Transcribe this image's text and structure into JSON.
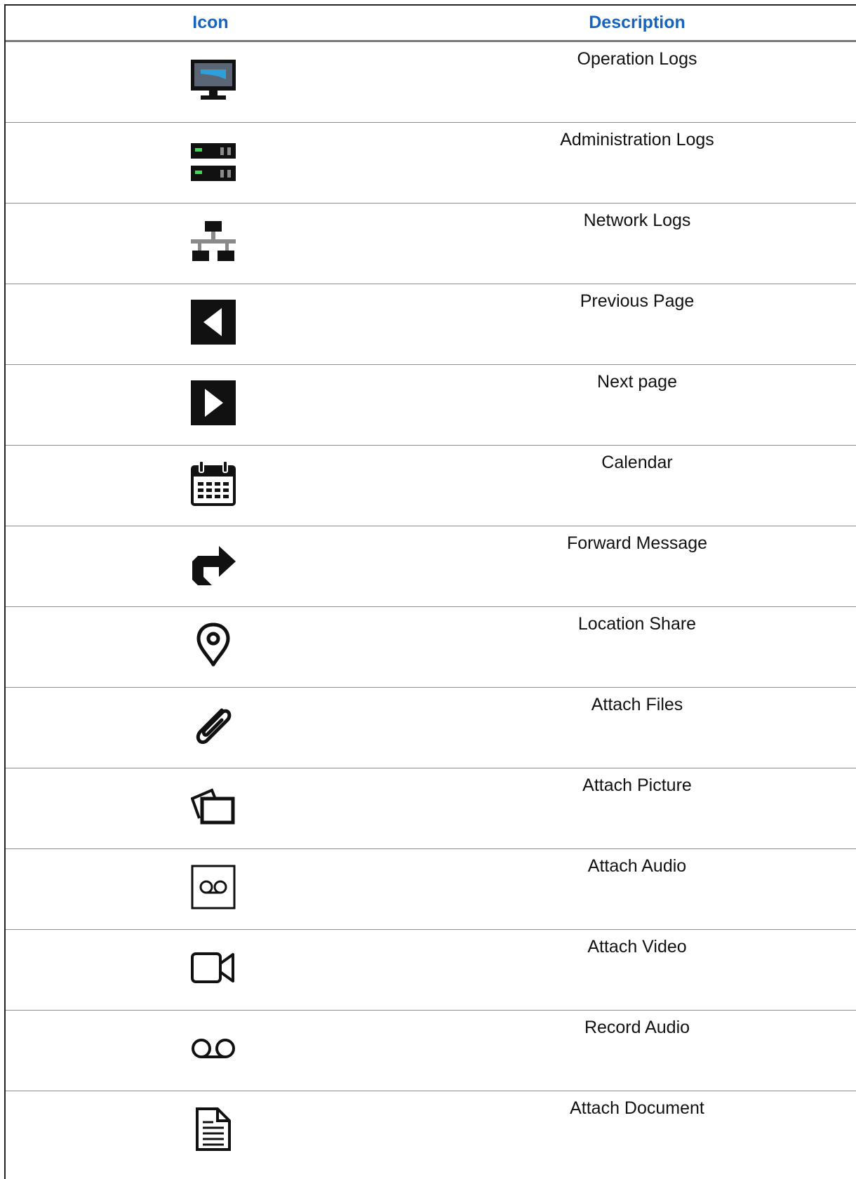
{
  "table": {
    "headers": {
      "icon": "Icon",
      "description": "Description"
    },
    "rows": [
      {
        "icon": "monitor-icon",
        "description": "Operation Logs"
      },
      {
        "icon": "server-icon",
        "description": "Administration Logs"
      },
      {
        "icon": "network-icon",
        "description": "Network Logs"
      },
      {
        "icon": "previous-page-icon",
        "description": "Previous Page"
      },
      {
        "icon": "next-page-icon",
        "description": "Next page"
      },
      {
        "icon": "calendar-icon",
        "description": "Calendar"
      },
      {
        "icon": "forward-arrow-icon",
        "description": "Forward Message"
      },
      {
        "icon": "location-pin-icon",
        "description": "Location Share"
      },
      {
        "icon": "paperclip-icon",
        "description": "Attach Files"
      },
      {
        "icon": "picture-icon",
        "description": "Attach Picture"
      },
      {
        "icon": "voicemail-box-icon",
        "description": "Attach Audio"
      },
      {
        "icon": "video-camera-icon",
        "description": "Attach Video"
      },
      {
        "icon": "voicemail-icon",
        "description": "Record Audio"
      },
      {
        "icon": "document-icon",
        "description": "Attach Document"
      }
    ]
  },
  "colors": {
    "header_text": "#1565c0",
    "monitor_screen": "#5b6573",
    "monitor_highlight": "#2e9fd8",
    "server_led": "#3ddc55",
    "network_gray": "#8a8a8a"
  }
}
